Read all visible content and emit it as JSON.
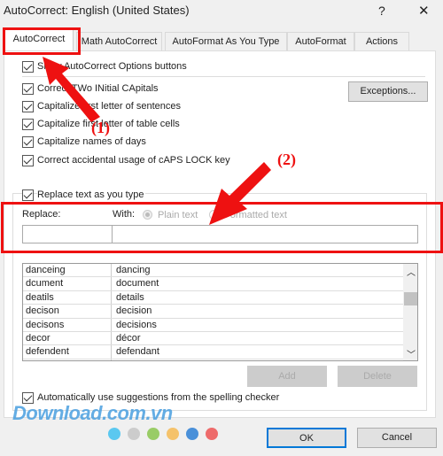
{
  "window": {
    "title": "AutoCorrect: English (United States)",
    "help": "?",
    "close": "✕"
  },
  "tabs": [
    {
      "label": "AutoCorrect"
    },
    {
      "label": "Math AutoCorrect"
    },
    {
      "label": "AutoFormat As You Type"
    },
    {
      "label": "AutoFormat"
    },
    {
      "label": "Actions"
    }
  ],
  "options": {
    "show_buttons": "Show AutoCorrect Options buttons",
    "two_initial": "Correct TWo INitial CApitals",
    "first_letter": "Capitalize first letter of sentences",
    "table_cells": "Capitalize first letter of table cells",
    "days": "Capitalize names of days",
    "caps_lock": "Correct accidental usage of cAPS LOCK key",
    "exceptions": "Exceptions...",
    "replace_as_type": "Replace text as you type",
    "auto_suggest": "Automatically use suggestions from the spelling checker"
  },
  "replace": {
    "replace_label": "Replace:",
    "with_label": "With:",
    "plain_text": "Plain text",
    "formatted_text": "Formatted text",
    "replace_value": "",
    "with_value": ""
  },
  "entries": [
    {
      "from": "danceing",
      "to": "dancing"
    },
    {
      "from": "dcument",
      "to": "document"
    },
    {
      "from": "deatils",
      "to": "details"
    },
    {
      "from": "decison",
      "to": "decision"
    },
    {
      "from": "decisons",
      "to": "decisions"
    },
    {
      "from": "decor",
      "to": "décor"
    },
    {
      "from": "defendent",
      "to": "defendant"
    }
  ],
  "buttons": {
    "add": "Add",
    "delete": "Delete",
    "ok": "OK",
    "cancel": "Cancel"
  },
  "annotations": {
    "step1": "(1)",
    "step2": "(2)",
    "color": "#ee1111"
  },
  "watermark": "Download.com.vn",
  "dots": [
    "#5bc8f0",
    "#cccccc",
    "#99cc66",
    "#f5c26b",
    "#4a90d9",
    "#ee6b6b"
  ]
}
